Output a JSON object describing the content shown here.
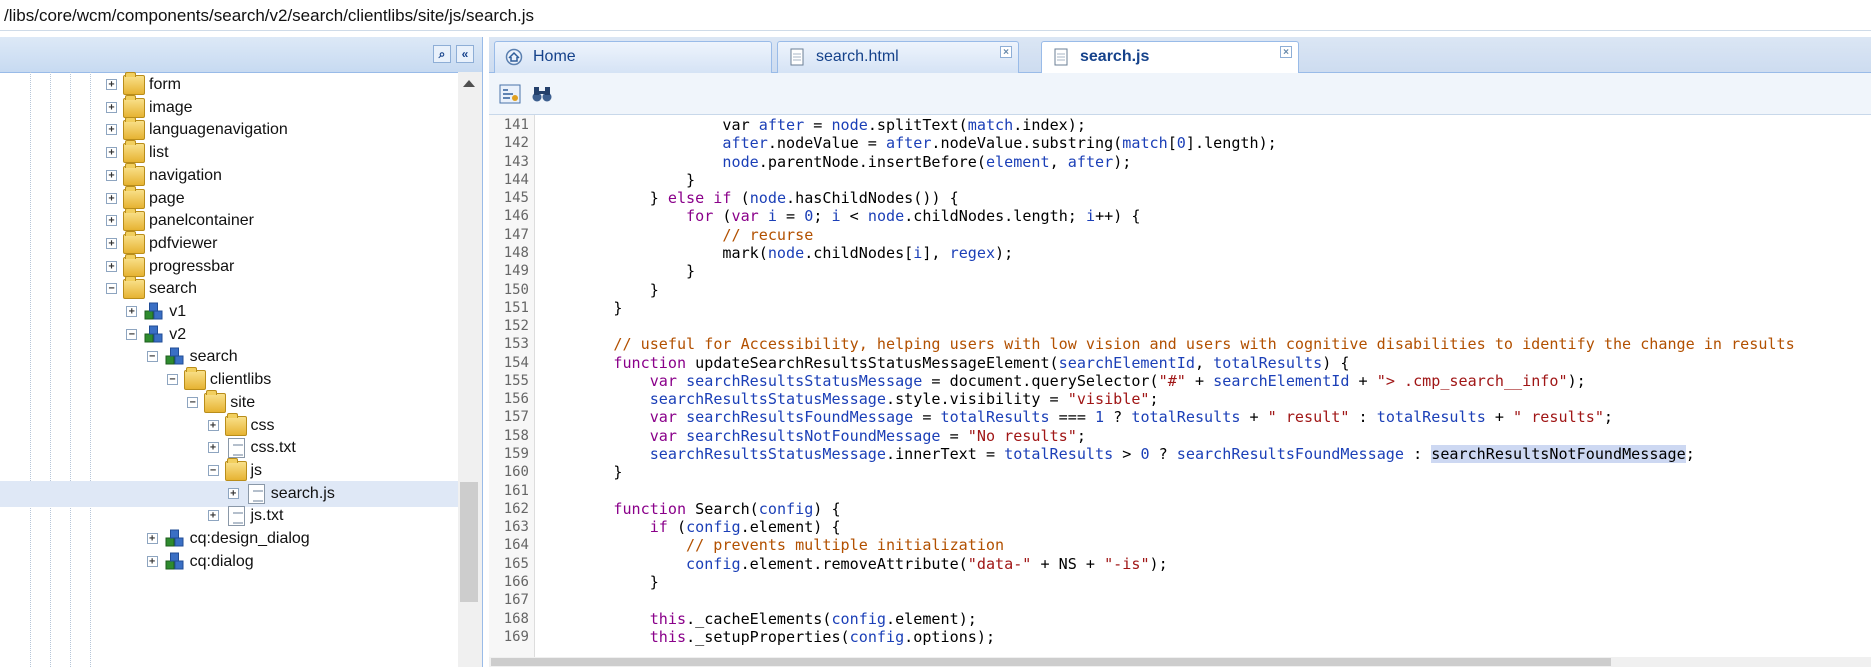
{
  "path": "/libs/core/wcm/components/search/v2/search/clientlibs/site/js/search.js",
  "tree": [
    {
      "label": "form",
      "icon": "folder-icon",
      "depth": 0,
      "expander": "+"
    },
    {
      "label": "image",
      "icon": "folder-icon",
      "depth": 0,
      "expander": "+"
    },
    {
      "label": "languagenavigation",
      "icon": "folder-icon",
      "depth": 0,
      "expander": "+"
    },
    {
      "label": "list",
      "icon": "folder-icon",
      "depth": 0,
      "expander": "+"
    },
    {
      "label": "navigation",
      "icon": "folder-icon",
      "depth": 0,
      "expander": "+"
    },
    {
      "label": "page",
      "icon": "folder-icon",
      "depth": 0,
      "expander": "+"
    },
    {
      "label": "panelcontainer",
      "icon": "folder-icon",
      "depth": 0,
      "expander": "+"
    },
    {
      "label": "pdfviewer",
      "icon": "folder-icon",
      "depth": 0,
      "expander": "+"
    },
    {
      "label": "progressbar",
      "icon": "folder-icon",
      "depth": 0,
      "expander": "+"
    },
    {
      "label": "search",
      "icon": "folder-icon",
      "depth": 0,
      "expander": "−"
    },
    {
      "label": "v1",
      "icon": "component-icon",
      "depth": 1,
      "expander": "+"
    },
    {
      "label": "v2",
      "icon": "component-icon",
      "depth": 1,
      "expander": "−"
    },
    {
      "label": "search",
      "icon": "component-icon",
      "depth": 2,
      "expander": "−"
    },
    {
      "label": "clientlibs",
      "icon": "folder-icon",
      "depth": 3,
      "expander": "−"
    },
    {
      "label": "site",
      "icon": "folder-icon",
      "depth": 4,
      "expander": "−"
    },
    {
      "label": "css",
      "icon": "folder-icon",
      "depth": 5,
      "expander": "+"
    },
    {
      "label": "css.txt",
      "icon": "file-icon",
      "depth": 5,
      "expander": "+"
    },
    {
      "label": "js",
      "icon": "folder-icon",
      "depth": 5,
      "expander": "−"
    },
    {
      "label": "search.js",
      "icon": "file-icon",
      "depth": 6,
      "expander": "+",
      "selected": true
    },
    {
      "label": "js.txt",
      "icon": "file-icon",
      "depth": 5,
      "expander": "+"
    },
    {
      "label": "cq:design_dialog",
      "icon": "component-icon",
      "depth": 2,
      "expander": "+"
    },
    {
      "label": "cq:dialog",
      "icon": "component-icon",
      "depth": 2,
      "expander": "+"
    }
  ],
  "tabs": {
    "home": "Home",
    "html": "search.html",
    "js": "search.js"
  },
  "code": {
    "first_line": 141,
    "lines": [
      [
        [
          "",
          "                var "
        ],
        [
          "v",
          "after"
        ],
        [
          "",
          " = "
        ],
        [
          "v",
          "node"
        ],
        [
          "",
          ".splitText("
        ],
        [
          "v",
          "match"
        ],
        [
          "",
          ".index);"
        ]
      ],
      [
        [
          "",
          "                "
        ],
        [
          "v",
          "after"
        ],
        [
          "",
          ".nodeValue = "
        ],
        [
          "v",
          "after"
        ],
        [
          "",
          ".nodeValue.substring("
        ],
        [
          "v",
          "match"
        ],
        [
          "",
          "["
        ],
        [
          "n",
          "0"
        ],
        [
          "",
          "].length);"
        ]
      ],
      [
        [
          "",
          "                "
        ],
        [
          "v",
          "node"
        ],
        [
          "",
          ".parentNode.insertBefore("
        ],
        [
          "v",
          "element"
        ],
        [
          "",
          ", "
        ],
        [
          "v",
          "after"
        ],
        [
          "",
          ");"
        ]
      ],
      [
        [
          "",
          "            }"
        ]
      ],
      [
        [
          "",
          "        } "
        ],
        [
          "k",
          "else if"
        ],
        [
          "",
          " ("
        ],
        [
          "v",
          "node"
        ],
        [
          "",
          ".hasChildNodes()) {"
        ]
      ],
      [
        [
          "",
          "            "
        ],
        [
          "k",
          "for"
        ],
        [
          "",
          " ("
        ],
        [
          "k",
          "var"
        ],
        [
          "",
          " "
        ],
        [
          "v",
          "i"
        ],
        [
          "",
          " = "
        ],
        [
          "n",
          "0"
        ],
        [
          "",
          "; "
        ],
        [
          "v",
          "i"
        ],
        [
          "",
          " < "
        ],
        [
          "v",
          "node"
        ],
        [
          "",
          ".childNodes.length; "
        ],
        [
          "v",
          "i"
        ],
        [
          "",
          "++) {"
        ]
      ],
      [
        [
          "",
          "                "
        ],
        [
          "c",
          "// recurse"
        ]
      ],
      [
        [
          "",
          "                mark("
        ],
        [
          "v",
          "node"
        ],
        [
          "",
          ".childNodes["
        ],
        [
          "v",
          "i"
        ],
        [
          "",
          "], "
        ],
        [
          "v",
          "regex"
        ],
        [
          "",
          ");"
        ]
      ],
      [
        [
          "",
          "            }"
        ]
      ],
      [
        [
          "",
          "        }"
        ]
      ],
      [
        [
          "",
          "    }"
        ]
      ],
      [
        [
          "",
          ""
        ]
      ],
      [
        [
          "",
          "    "
        ],
        [
          "c",
          "// useful for Accessibility, helping users with low vision and users with cognitive disabilities to identify the change in results"
        ]
      ],
      [
        [
          "",
          "    "
        ],
        [
          "k",
          "function"
        ],
        [
          "",
          " updateSearchResultsStatusMessageElement("
        ],
        [
          "v",
          "searchElementId"
        ],
        [
          "",
          ", "
        ],
        [
          "v",
          "totalResults"
        ],
        [
          "",
          ") {"
        ]
      ],
      [
        [
          "",
          "        "
        ],
        [
          "k",
          "var"
        ],
        [
          "",
          " "
        ],
        [
          "v",
          "searchResultsStatusMessage"
        ],
        [
          "",
          " = document.querySelector("
        ],
        [
          "s",
          "\"#\""
        ],
        [
          "",
          " + "
        ],
        [
          "v",
          "searchElementId"
        ],
        [
          "",
          " + "
        ],
        [
          "s",
          "\"> .cmp_search__info\""
        ],
        [
          "",
          ");"
        ]
      ],
      [
        [
          "",
          "        "
        ],
        [
          "v",
          "searchResultsStatusMessage"
        ],
        [
          "",
          ".style.visibility = "
        ],
        [
          "s",
          "\"visible\""
        ],
        [
          "",
          ";"
        ]
      ],
      [
        [
          "",
          "        "
        ],
        [
          "k",
          "var"
        ],
        [
          "",
          " "
        ],
        [
          "v",
          "searchResultsFoundMessage"
        ],
        [
          "",
          " = "
        ],
        [
          "v",
          "totalResults"
        ],
        [
          "",
          " === "
        ],
        [
          "n",
          "1"
        ],
        [
          "",
          " ? "
        ],
        [
          "v",
          "totalResults"
        ],
        [
          "",
          " + "
        ],
        [
          "s",
          "\" result\""
        ],
        [
          "",
          " : "
        ],
        [
          "v",
          "totalResults"
        ],
        [
          "",
          " + "
        ],
        [
          "s",
          "\" results\""
        ],
        [
          "",
          ";"
        ]
      ],
      [
        [
          "",
          "        "
        ],
        [
          "k",
          "var"
        ],
        [
          "",
          " "
        ],
        [
          "v",
          "searchResultsNotFoundMessage"
        ],
        [
          "",
          " = "
        ],
        [
          "s",
          "\"No results\""
        ],
        [
          "",
          ";"
        ]
      ],
      [
        [
          "",
          "        "
        ],
        [
          "v",
          "searchResultsStatusMessage"
        ],
        [
          "",
          ".innerText = "
        ],
        [
          "v",
          "totalResults"
        ],
        [
          "",
          " > "
        ],
        [
          "n",
          "0"
        ],
        [
          "",
          " ? "
        ],
        [
          "v",
          "searchResultsFoundMessage"
        ],
        [
          "",
          " : "
        ],
        [
          "hl",
          "searchResultsNotFoundMessage"
        ],
        [
          "",
          ";"
        ]
      ],
      [
        [
          "",
          "    }"
        ]
      ],
      [
        [
          "",
          ""
        ]
      ],
      [
        [
          "",
          "    "
        ],
        [
          "k",
          "function"
        ],
        [
          "",
          " Search("
        ],
        [
          "v",
          "config"
        ],
        [
          "",
          ") {"
        ]
      ],
      [
        [
          "",
          "        "
        ],
        [
          "k",
          "if"
        ],
        [
          "",
          " ("
        ],
        [
          "v",
          "config"
        ],
        [
          "",
          ".element) {"
        ]
      ],
      [
        [
          "",
          "            "
        ],
        [
          "c",
          "// prevents multiple initialization"
        ]
      ],
      [
        [
          "",
          "            "
        ],
        [
          "v",
          "config"
        ],
        [
          "",
          ".element.removeAttribute("
        ],
        [
          "s",
          "\"data-\""
        ],
        [
          "",
          " + NS + "
        ],
        [
          "s",
          "\"-is\""
        ],
        [
          "",
          ");"
        ]
      ],
      [
        [
          "",
          "        }"
        ]
      ],
      [
        [
          "",
          ""
        ]
      ],
      [
        [
          "",
          "        "
        ],
        [
          "k",
          "this"
        ],
        [
          "",
          "._cacheElements("
        ],
        [
          "v",
          "config"
        ],
        [
          "",
          ".element);"
        ]
      ],
      [
        [
          "",
          "        "
        ],
        [
          "k",
          "this"
        ],
        [
          "",
          "._setupProperties("
        ],
        [
          "v",
          "config"
        ],
        [
          "",
          ".options);"
        ]
      ]
    ]
  }
}
